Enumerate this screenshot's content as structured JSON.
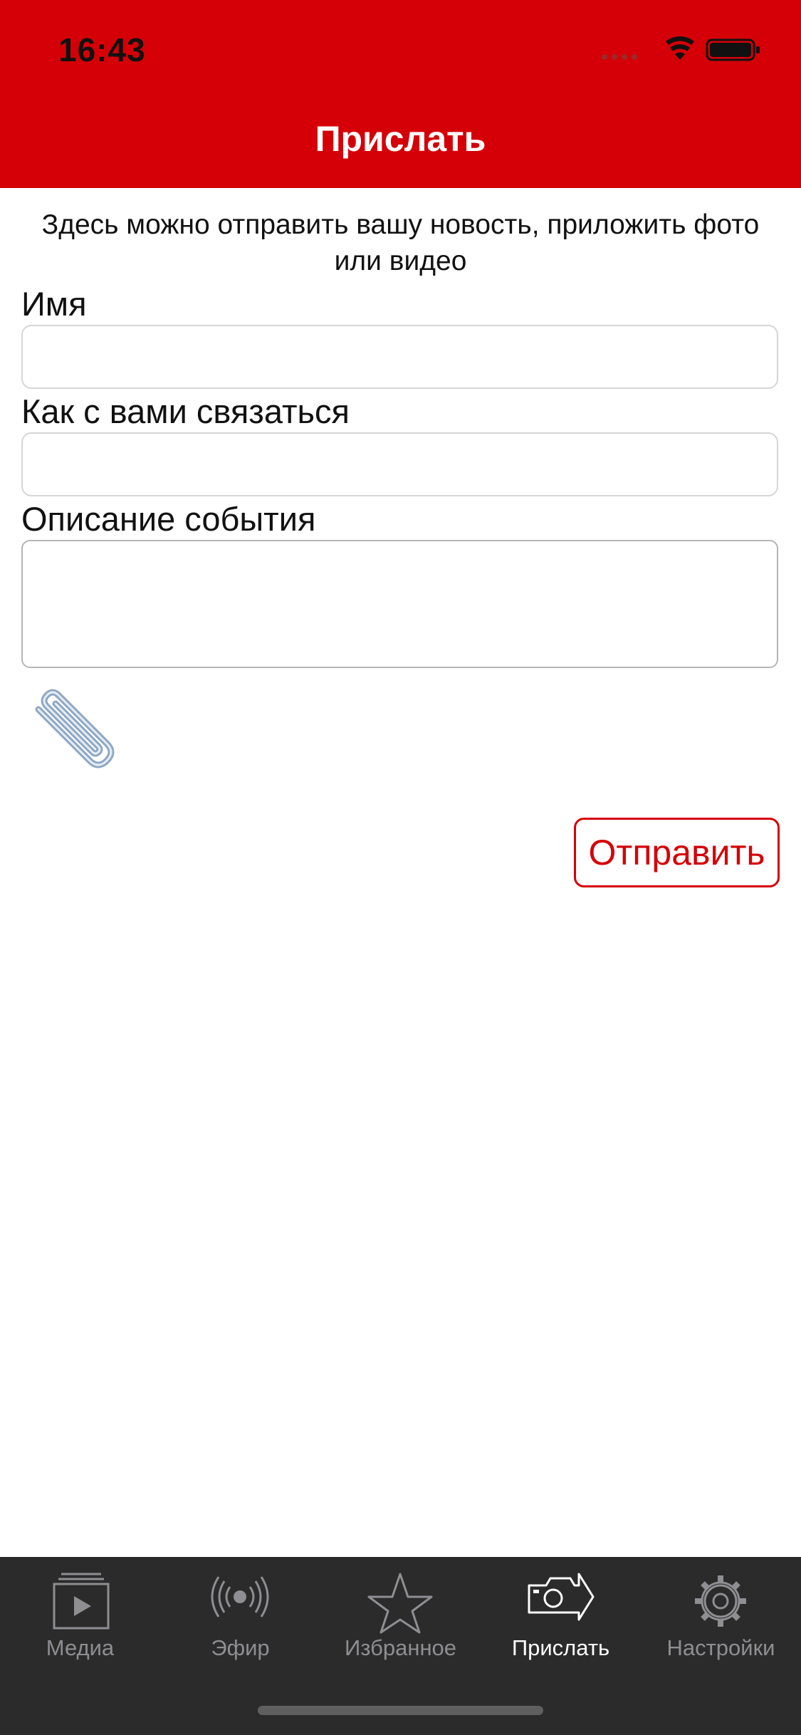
{
  "status_bar": {
    "time": "16:43"
  },
  "header": {
    "title": "Прислать"
  },
  "form": {
    "intro": "Здесь можно отправить вашу новость, приложить фото или видео",
    "name_label": "Имя",
    "name_value": "",
    "contact_label": "Как с вами связаться",
    "contact_value": "",
    "description_label": "Описание события",
    "description_value": "",
    "attach_icon": "paperclip-icon",
    "send_label": "Отправить"
  },
  "tabs": [
    {
      "label": "Медиа",
      "icon": "media-play-icon",
      "active": false
    },
    {
      "label": "Эфир",
      "icon": "broadcast-icon",
      "active": false
    },
    {
      "label": "Избранное",
      "icon": "star-icon",
      "active": false
    },
    {
      "label": "Прислать",
      "icon": "camera-send-icon",
      "active": true
    },
    {
      "label": "Настройки",
      "icon": "gear-icon",
      "active": false
    }
  ],
  "colors": {
    "accent": "#d50007",
    "tabbar": "#2b2b2b",
    "tab_inactive": "#8e8e93",
    "tab_active": "#ffffff"
  }
}
